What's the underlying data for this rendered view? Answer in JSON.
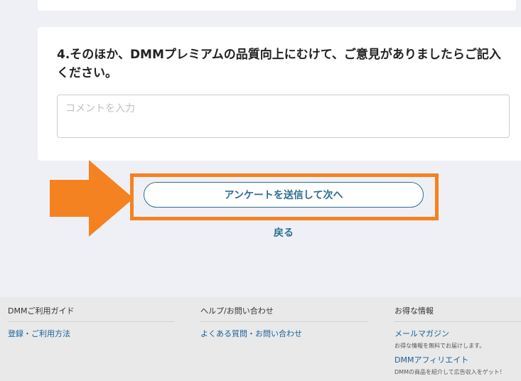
{
  "question4": {
    "title": "4.そのほか、DMMプレミアムの品質向上にむけて、ご意見がありましたらご記入ください。",
    "comment_placeholder": "コメントを入力",
    "comment_value": ""
  },
  "actions": {
    "submit_label": "アンケートを送信して次へ",
    "back_label": "戻る"
  },
  "annotation": {
    "color": "#f58220"
  },
  "footer": {
    "col1": {
      "heading": "DMMご利用ガイド",
      "links": [
        "登録・ご利用方法"
      ]
    },
    "col2": {
      "heading": "ヘルプ/お問い合わせ",
      "links": [
        "よくある質問・お問い合わせ"
      ]
    },
    "col3": {
      "heading": "お得な情報",
      "items": [
        {
          "title": "メールマガジン",
          "desc": "お得な情報を無料でお届けします。"
        },
        {
          "title": "DMMアフィリエイト",
          "desc": "DMMの商品を紹介して広告収入をゲット！"
        }
      ]
    }
  }
}
